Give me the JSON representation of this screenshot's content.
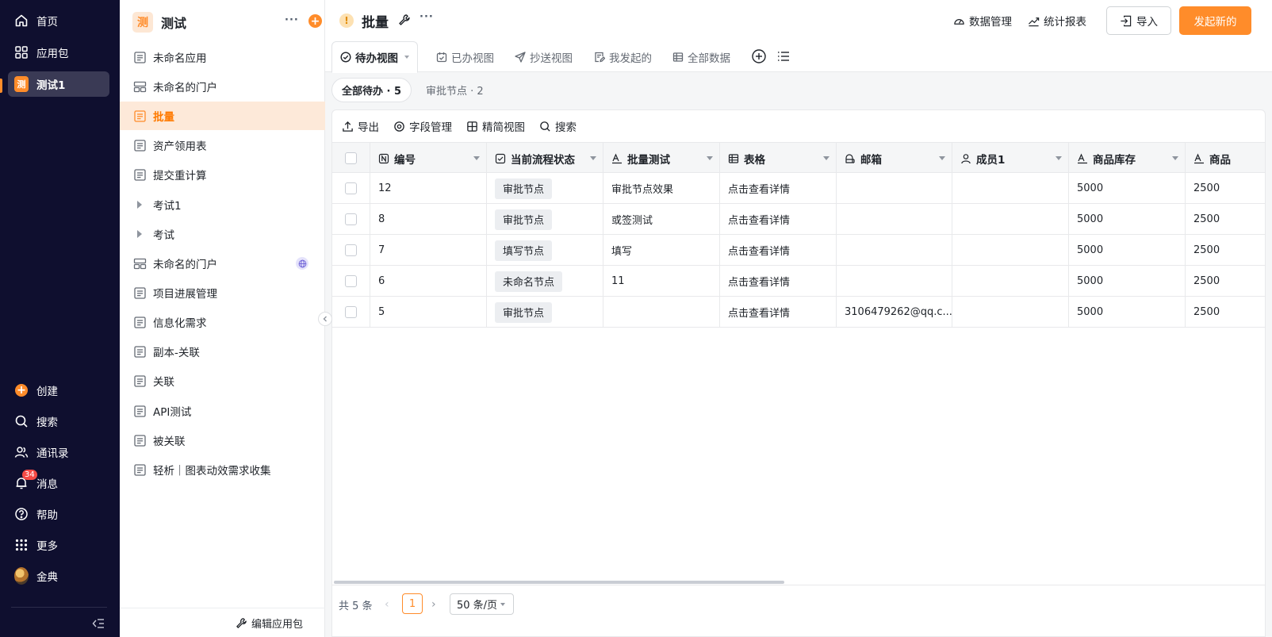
{
  "nav": {
    "items": [
      {
        "label": "首页",
        "icon": "home-icon"
      },
      {
        "label": "应用包",
        "icon": "grid-icon"
      },
      {
        "label": "测试1",
        "icon": "app-badge-icon",
        "badge_text": "测",
        "active": true
      }
    ],
    "bottom_items": [
      {
        "label": "创建",
        "icon": "plus-circle-icon"
      },
      {
        "label": "搜索",
        "icon": "search-icon"
      },
      {
        "label": "通讯录",
        "icon": "contacts-icon"
      },
      {
        "label": "消息",
        "icon": "bell-icon",
        "badge": "34"
      },
      {
        "label": "帮助",
        "icon": "help-icon"
      },
      {
        "label": "更多",
        "icon": "apps-icon"
      },
      {
        "label": "金典",
        "icon": "avatar"
      }
    ],
    "accent": "#ff8c2a",
    "bg": "#0f0f2f"
  },
  "sidebar": {
    "app_logo_text": "测",
    "app_title": "测试",
    "items": [
      {
        "label": "未命名应用",
        "icon": "form-icon"
      },
      {
        "label": "未命名的门户",
        "icon": "portal-icon"
      },
      {
        "label": "批量",
        "icon": "form-icon",
        "active": true
      },
      {
        "label": "资产领用表",
        "icon": "form-icon"
      },
      {
        "label": "提交重计算",
        "icon": "form-icon"
      },
      {
        "label": "考试1",
        "icon": "expand-arrow-icon"
      },
      {
        "label": "考试",
        "icon": "expand-arrow-icon"
      },
      {
        "label": "未命名的门户",
        "icon": "portal-icon",
        "badge": "globe-icon"
      },
      {
        "label": "项目进展管理",
        "icon": "form-icon"
      },
      {
        "label": "信息化需求",
        "icon": "form-icon"
      },
      {
        "label": "副本-关联",
        "icon": "form-icon"
      },
      {
        "label": "关联",
        "icon": "form-icon"
      },
      {
        "label": "API测试",
        "icon": "form-icon"
      },
      {
        "label": "被关联",
        "icon": "form-icon"
      },
      {
        "label": "轻析｜图表动效需求收集",
        "icon": "form-icon"
      }
    ],
    "footer_label": "编辑应用包"
  },
  "topbar": {
    "title": "批量",
    "data_manage": "数据管理",
    "stats_report": "统计报表",
    "import_label": "导入",
    "launch_label": "发起新的"
  },
  "view_tabs": [
    {
      "label": "待办视图",
      "icon": "check-circle-icon",
      "active": true
    },
    {
      "label": "已办视图",
      "icon": "calendar-check-icon"
    },
    {
      "label": "抄送视图",
      "icon": "send-icon"
    },
    {
      "label": "我发起的",
      "icon": "doc-edit-icon"
    },
    {
      "label": "全部数据",
      "icon": "table-icon"
    }
  ],
  "filters": {
    "all_todo": "全部待办 · 5",
    "approval_node": "审批节点 · 2"
  },
  "toolbar": {
    "export": "导出",
    "field_manage": "字段管理",
    "compact_view": "精简视图",
    "search": "搜索"
  },
  "table": {
    "columns": [
      {
        "label": "编号",
        "icon": "number-icon"
      },
      {
        "label": "当前流程状态",
        "icon": "checkbox-icon"
      },
      {
        "label": "批量测试",
        "icon": "text-icon"
      },
      {
        "label": "表格",
        "icon": "table-icon"
      },
      {
        "label": "邮箱",
        "icon": "mailbox-icon"
      },
      {
        "label": "成员1",
        "icon": "user-icon"
      },
      {
        "label": "商品库存",
        "icon": "text-icon"
      },
      {
        "label": "商品",
        "icon": "text-icon"
      }
    ],
    "rows": [
      {
        "id": "12",
        "status": "审批节点",
        "batch": "审批节点效果",
        "table": "点击查看详情",
        "email": "",
        "member": "",
        "stock": "5000",
        "goods": "2500"
      },
      {
        "id": "8",
        "status": "审批节点",
        "batch": "或签测试",
        "table": "点击查看详情",
        "email": "",
        "member": "",
        "stock": "5000",
        "goods": "2500"
      },
      {
        "id": "7",
        "status": "填写节点",
        "batch": "填写",
        "table": "点击查看详情",
        "email": "",
        "member": "",
        "stock": "5000",
        "goods": "2500"
      },
      {
        "id": "6",
        "status": "未命名节点",
        "batch": "11",
        "table": "点击查看详情",
        "email": "",
        "member": "",
        "stock": "5000",
        "goods": "2500"
      },
      {
        "id": "5",
        "status": "审批节点",
        "batch": "",
        "table": "点击查看详情",
        "email": "3106479262@qq.c...",
        "member": "",
        "stock": "5000",
        "goods": "2500"
      }
    ]
  },
  "pager": {
    "total": "共 5 条",
    "current": "1",
    "page_size": "50 条/页"
  }
}
